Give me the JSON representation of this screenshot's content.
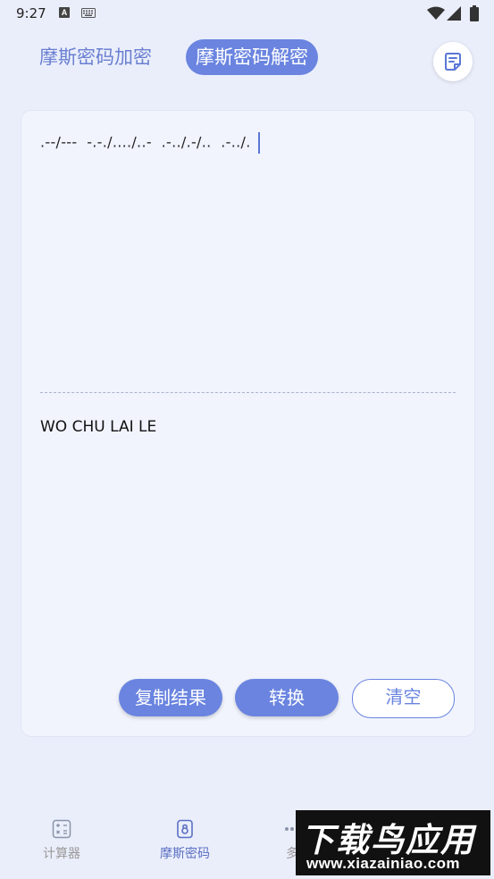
{
  "status_bar": {
    "time": "9:27",
    "indicator_letter": "A"
  },
  "mode_tabs": [
    {
      "label": "摩斯密码加密",
      "active": false
    },
    {
      "label": "摩斯密码解密",
      "active": true
    }
  ],
  "editor": {
    "input_text": ".--/---  -.-./..../..-  .-../.-/..  .-../.",
    "output_text": "WO CHU LAI LE"
  },
  "actions": {
    "copy_label": "复制结果",
    "convert_label": "转换",
    "clear_label": "清空"
  },
  "bottom_nav": [
    {
      "label": "计算器",
      "icon": "calculator-icon",
      "active": false
    },
    {
      "label": "摩斯密码",
      "icon": "lock-icon",
      "active": true
    },
    {
      "label": "多",
      "icon": "more-icon",
      "active": false
    }
  ],
  "watermark": {
    "title": "下载鸟应用",
    "url": "www.xiazainiao.com"
  },
  "colors": {
    "accent": "#6a84e0",
    "background": "#eaeefb",
    "card": "#f1f4fd"
  }
}
